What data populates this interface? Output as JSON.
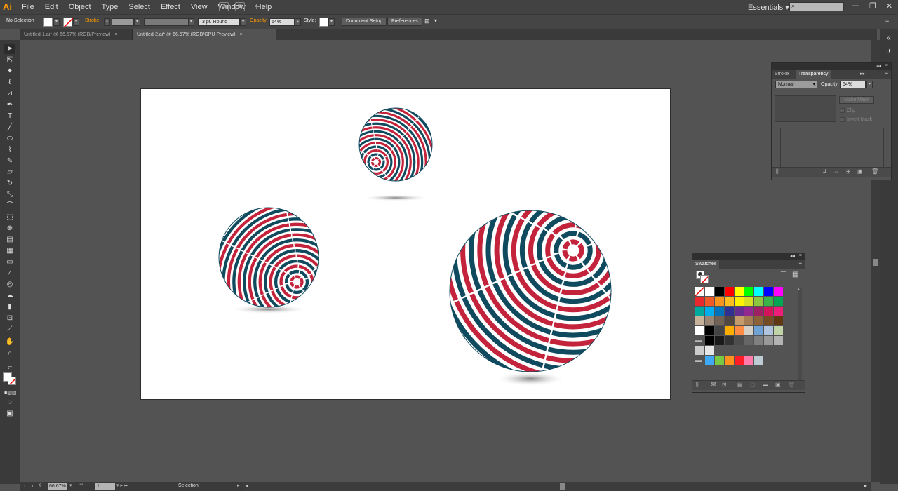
{
  "app": {
    "logo": "Ai"
  },
  "menu": [
    "File",
    "Edit",
    "Object",
    "Type",
    "Select",
    "Effect",
    "View",
    "Window",
    "Help"
  ],
  "menubar": {
    "br_label": "Br",
    "workspace": "Essentials",
    "workspace_caret": "▾"
  },
  "control": {
    "selection_state": "No Selection",
    "stroke_label": "Stroke:",
    "brush": "3 pt. Round",
    "opacity_label": "Opacity:",
    "opacity_value": "54%",
    "style_label": "Style:",
    "doc_setup": "Document Setup",
    "preferences": "Preferences"
  },
  "tabs": [
    {
      "label": "Untitled-1.ai* @ 66,67% (RGB/Preview)",
      "close": "×",
      "active": false
    },
    {
      "label": "Untitled-2.ai* @ 66,67% (RGB/GPU Preview)",
      "close": "×",
      "active": true
    }
  ],
  "status": {
    "zoom": "66.67%",
    "page": "1",
    "mode": "Selection"
  },
  "transparency_panel": {
    "tab_stroke": "Stroke",
    "tab_transparency": "Transparency",
    "blend_mode": "Normal",
    "opacity_label": "Opacity:",
    "opacity_value": "54%",
    "make_mask": "Make Mask",
    "clip": "Clip",
    "invert_mask": "Invert Mask"
  },
  "swatches_panel": {
    "title": "Swatches",
    "rows": [
      [
        "none",
        "#ffffff",
        "#000000",
        "#ff0000",
        "#ffff00",
        "#00ff00",
        "#00ffff",
        "#0000ff",
        "#ff00ff"
      ],
      [
        "#e8282d",
        "#f05a28",
        "#f7941d",
        "#fcbf1f",
        "#fff200",
        "#d7df23",
        "#8dc63f",
        "#39b54a",
        "#00a651"
      ],
      [
        "#00a99d",
        "#00aeef",
        "#0072bc",
        "#2e3192",
        "#662d91",
        "#92278f",
        "#9e1f63",
        "#d4145a",
        "#ed1e79"
      ],
      [
        "#c7b299",
        "#998675",
        "#736357",
        "#534741",
        "#c69c6d",
        "#a67c52",
        "#8c6239",
        "#754c24",
        "#603913"
      ],
      [
        "#ffffff",
        "#000000",
        "#444444",
        "#ffae00",
        "#ff8c42",
        "#d4d0c8",
        "#6fa3d6",
        "#b0c4de",
        "#c1d4a7"
      ],
      [
        "folder",
        "#000000",
        "#1a1a1a",
        "#333333",
        "#4d4d4d",
        "#666666",
        "#808080",
        "#999999",
        "#b3b3b3"
      ],
      [
        "#cccccc",
        "#e6e6e6"
      ],
      [
        "folder",
        "#3fa9f5",
        "#7ac943",
        "#ff931e",
        "#ff1d25",
        "#ff7bac",
        "#bdccd4"
      ]
    ]
  },
  "colors": {
    "red": "#c4233c",
    "navy": "#0f4a5e",
    "accent_orange": "#ff9a00"
  },
  "icons": [
    "selection-tool-icon",
    "direct-selection-tool-icon",
    "magic-wand-icon",
    "lasso-icon",
    "pen-tool-icon",
    "type-tool-icon",
    "line-tool-icon",
    "ellipse-tool-icon",
    "paintbrush-icon",
    "pencil-icon",
    "eraser-icon",
    "rotate-icon",
    "scale-icon",
    "warp-icon",
    "free-transform-icon",
    "shape-builder-icon",
    "perspective-grid-icon",
    "mesh-icon",
    "gradient-icon",
    "eyedropper-icon",
    "blend-icon",
    "symbol-sprayer-icon",
    "column-graph-icon",
    "artboard-icon",
    "slice-icon",
    "hand-icon",
    "zoom-icon"
  ]
}
